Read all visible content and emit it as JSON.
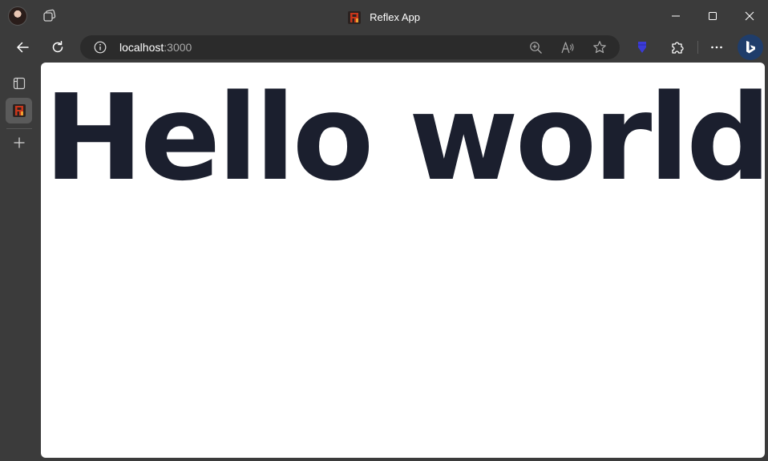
{
  "window": {
    "title": "Reflex App",
    "minimize_icon": "minimize-icon",
    "maximize_icon": "maximize-icon",
    "close_icon": "close-icon"
  },
  "toolbar": {
    "url_host": "localhost",
    "url_port": ":3000",
    "icons": [
      "back-icon",
      "refresh-icon",
      "info-icon",
      "zoom-icon",
      "read-aloud-icon",
      "favorite-star-icon",
      "extension-icon",
      "puzzle-extensions-icon",
      "more-icon",
      "bing-copilot-icon"
    ]
  },
  "sidebar": {
    "icons": [
      "tab-actions-icon",
      "reflex-tab-favicon",
      "new-tab-plus-icon"
    ]
  },
  "page": {
    "heading": "Hello world!"
  },
  "colors": {
    "chrome_bg": "#3b3b3b",
    "address_bg": "#2b2b2b",
    "page_bg": "#ffffff",
    "heading_text": "#1b1f2e",
    "extension_accent": "#3b3bd6"
  }
}
